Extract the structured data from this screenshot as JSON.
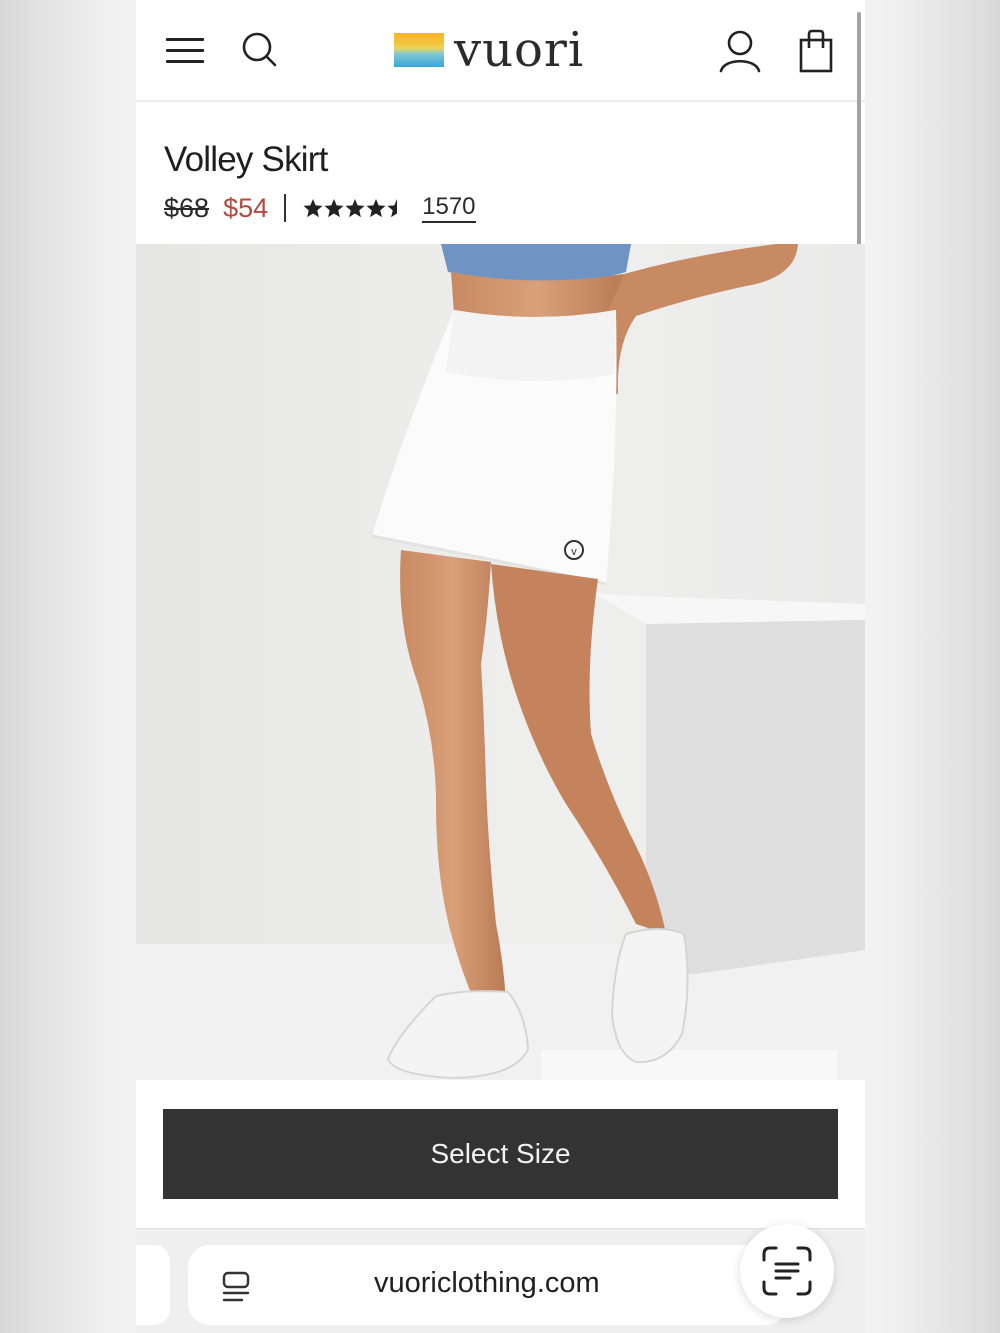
{
  "header": {
    "logo_text": "vuori",
    "menu_icon": "hamburger-menu-icon",
    "search_icon": "search-icon",
    "account_icon": "user-icon",
    "bag_icon": "shopping-bag-icon"
  },
  "product": {
    "title": "Volley Skirt",
    "price_original": "$68",
    "price_sale": "$54",
    "rating": 4.5,
    "rating_max": 5,
    "review_count": "1570",
    "image_icon": "product-photo-white-skirt"
  },
  "cta": {
    "select_size_label": "Select Size"
  },
  "browser": {
    "url": "vuoriclothing.com",
    "reader_icon": "page-menu-icon",
    "scan_icon": "text-scan-icon"
  },
  "colors": {
    "sale_price": "#b24a3f",
    "button_bg": "#333333",
    "logo_gradient_top": "#f7b32b",
    "logo_gradient_bottom": "#38a6d7"
  }
}
